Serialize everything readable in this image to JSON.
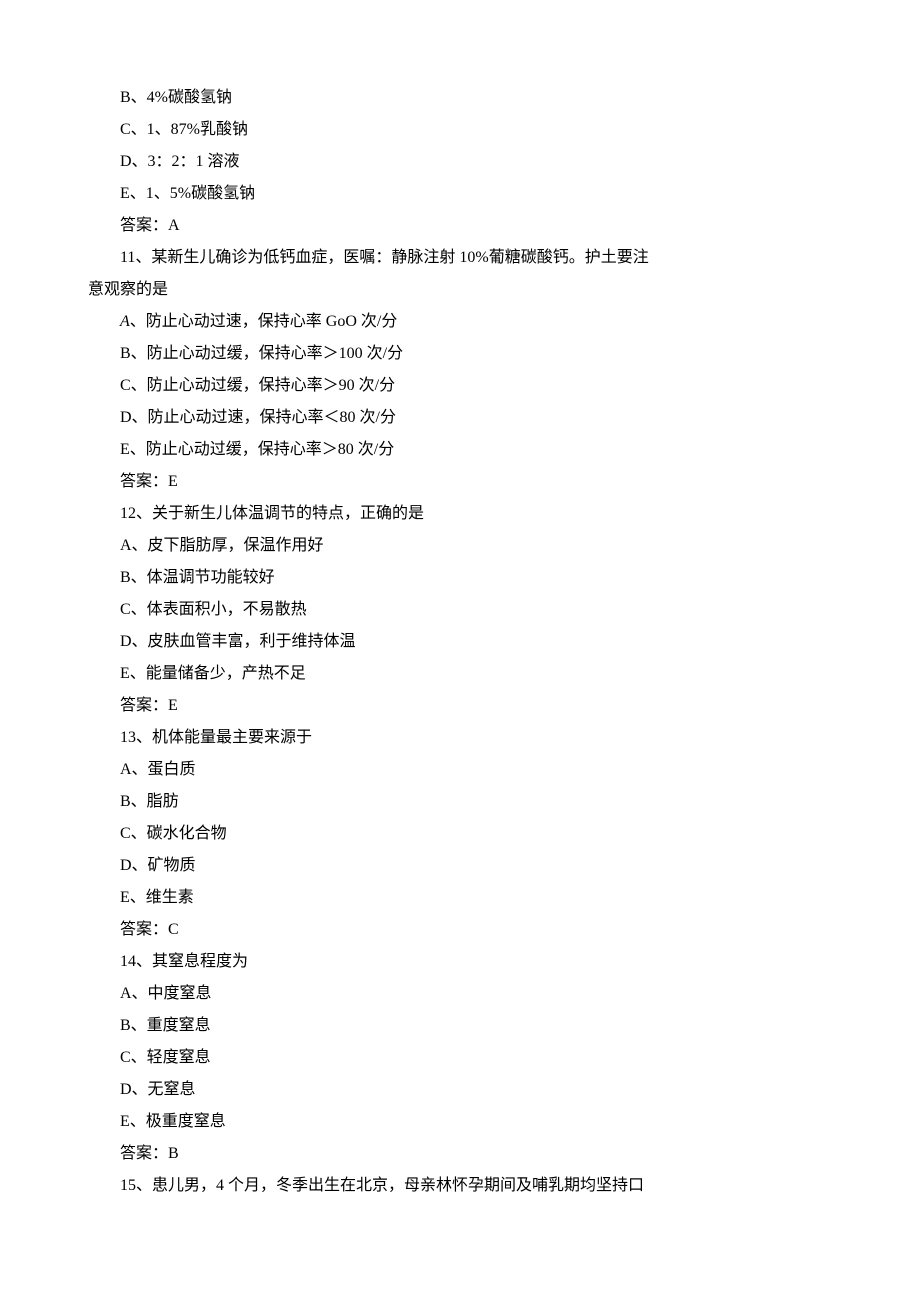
{
  "lines": [
    {
      "text": "B、4%碳酸氢钠"
    },
    {
      "text": "C、1、87%乳酸钠"
    },
    {
      "text": "D、3：2：1 溶液"
    },
    {
      "text": "E、1、5%碳酸氢钠"
    },
    {
      "text": "答案：A"
    },
    {
      "text": "11、某新生儿确诊为低钙血症，医嘱：静脉注射 10%葡糖碳酸钙。护土要注"
    },
    {
      "text": "意观察的是",
      "flush": true
    },
    {
      "text": "A、防止心动过速，保持心率 GoO 次/分",
      "italicFirst": true
    },
    {
      "text": "B、防止心动过缓，保持心率＞100 次/分"
    },
    {
      "text": "C、防止心动过缓，保持心率＞90 次/分"
    },
    {
      "text": "D、防止心动过速，保持心率＜80 次/分"
    },
    {
      "text": "E、防止心动过缓，保持心率＞80 次/分"
    },
    {
      "text": "答案：E"
    },
    {
      "text": "12、关于新生儿体温调节的特点，正确的是"
    },
    {
      "text": "A、皮下脂肪厚，保温作用好"
    },
    {
      "text": "B、体温调节功能较好"
    },
    {
      "text": "C、体表面积小，不易散热"
    },
    {
      "text": "D、皮肤血管丰富，利于维持体温"
    },
    {
      "text": "E、能量储备少，产热不足"
    },
    {
      "text": "答案：E"
    },
    {
      "text": "13、机体能量最主要来源于"
    },
    {
      "text": "A、蛋白质"
    },
    {
      "text": "B、脂肪"
    },
    {
      "text": "C、碳水化合物"
    },
    {
      "text": "D、矿物质"
    },
    {
      "text": "E、维生素"
    },
    {
      "text": "答案：C"
    },
    {
      "text": "14、其窒息程度为"
    },
    {
      "text": "A、中度窒息"
    },
    {
      "text": "B、重度窒息"
    },
    {
      "text": "C、轻度窒息"
    },
    {
      "text": "D、无窒息"
    },
    {
      "text": "E、极重度窒息"
    },
    {
      "text": "答案：B"
    },
    {
      "text": "15、患儿男，4 个月，冬季出生在北京，母亲林怀孕期间及哺乳期均坚持口"
    }
  ]
}
